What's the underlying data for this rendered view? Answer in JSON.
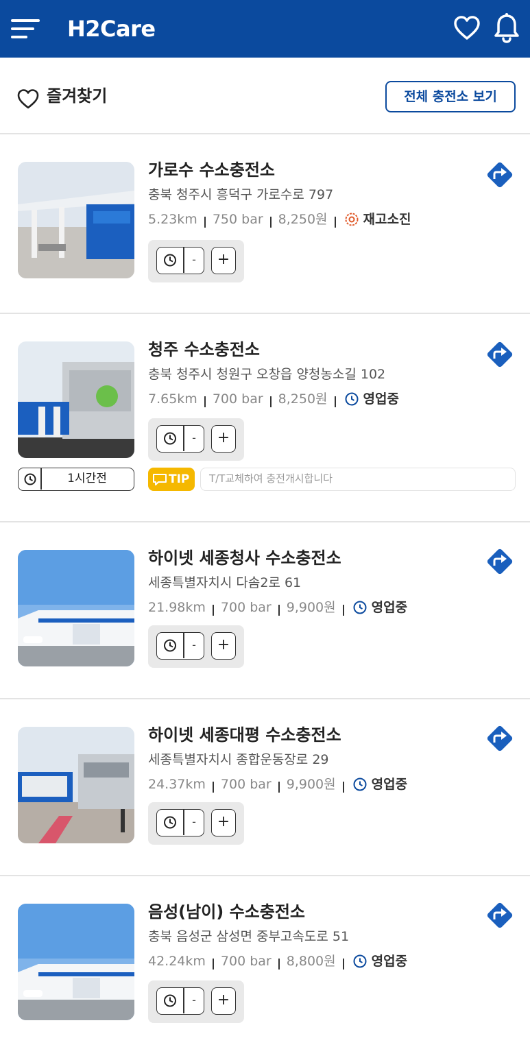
{
  "header": {
    "logo_text": "H2Care",
    "brand_color": "#0b4a9e"
  },
  "favorites": {
    "title": "즐겨찾기",
    "view_all_label": "전체 충전소 보기"
  },
  "stations": [
    {
      "name": "가로수 수소충전소",
      "address": "충북 청주시 흥덕구 가로수로 797",
      "distance": "5.23km",
      "pressure": "750 bar",
      "price": "8,250원",
      "status": "재고소진",
      "status_icon": "gear-icon",
      "status_color": "#e05a2a",
      "minus_label": "-",
      "plus_label": "+"
    },
    {
      "name": "청주 수소충전소",
      "address": "충북 청주시 청원구 오창읍 양청농소길 102",
      "distance": "7.65km",
      "pressure": "700 bar",
      "price": "8,250원",
      "status": "영업중",
      "status_icon": "clock-icon",
      "status_color": "#0b4a9e",
      "minus_label": "-",
      "plus_label": "+",
      "recent_label": "1시간전",
      "tip_label": "TIP",
      "tip_placeholder": "T/T교체하여 충전개시합니다"
    },
    {
      "name": "하이넷 세종청사 수소충전소",
      "address": "세종특별자치시 다솜2로 61",
      "distance": "21.98km",
      "pressure": "700 bar",
      "price": "9,900원",
      "status": "영업중",
      "status_icon": "clock-icon",
      "status_color": "#0b4a9e",
      "minus_label": "-",
      "plus_label": "+"
    },
    {
      "name": "하이넷 세종대평 수소충전소",
      "address": "세종특별자치시 종합운동장로 29",
      "distance": "24.37km",
      "pressure": "700 bar",
      "price": "9,900원",
      "status": "영업중",
      "status_icon": "clock-icon",
      "status_color": "#0b4a9e",
      "minus_label": "-",
      "plus_label": "+"
    },
    {
      "name": "음성(남이) 수소충전소",
      "address": "충북 음성군 삼성면 중부고속도로 51",
      "distance": "42.24km",
      "pressure": "700 bar",
      "price": "8,800원",
      "status": "영업중",
      "status_icon": "clock-icon",
      "status_color": "#0b4a9e",
      "minus_label": "-",
      "plus_label": "+"
    }
  ]
}
